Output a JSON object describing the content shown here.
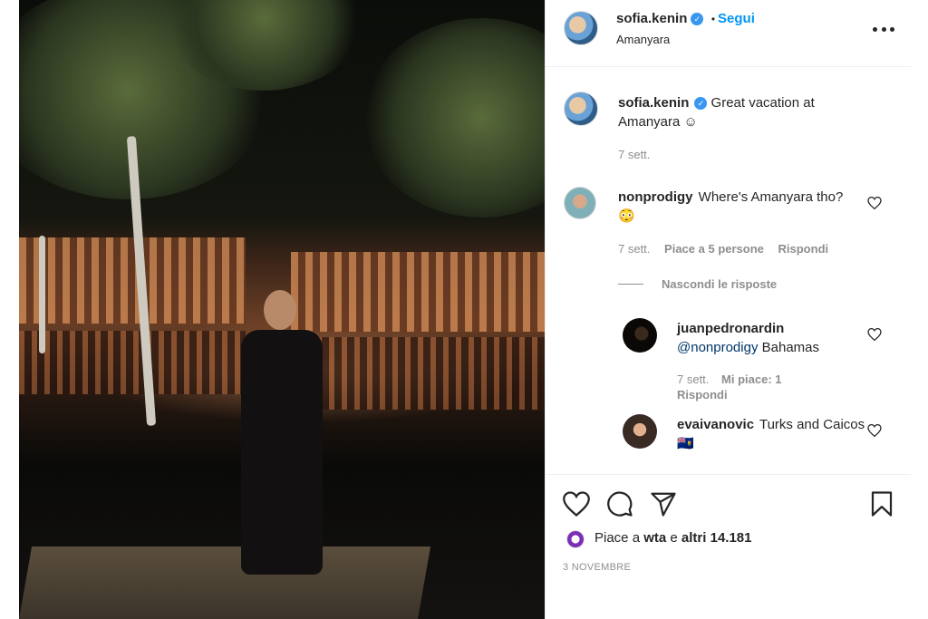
{
  "post": {
    "author": "sofia.kenin",
    "follow_label": "Segui",
    "separator": "•",
    "location": "Amanyara",
    "verified_glyph": "✓"
  },
  "caption": {
    "username": "sofia.kenin",
    "text": "Great vacation at Amanyara ☺",
    "time": "7 sett."
  },
  "comments": [
    {
      "username": "nonprodigy",
      "text": "Where's Amanyara tho? 😳",
      "time": "7 sett.",
      "likes": "Piace a 5 persone",
      "reply_label": "Rispondi"
    }
  ],
  "hide_replies_label": "Nascondi le risposte",
  "replies": [
    {
      "username": "juanpedronardin",
      "mention": "@nonprodigy",
      "text": "Bahamas",
      "time": "7 sett.",
      "likes": "Mi piace: 1",
      "reply_label": "Rispondi"
    },
    {
      "username": "evaivanovic",
      "text": "Turks and Caicos 🇹🇨"
    }
  ],
  "likes_line": {
    "prefix": "Piace a",
    "user": "wta",
    "middle": "e",
    "others": "altri 14.181"
  },
  "date": "3 NOVEMBRE",
  "icons": {
    "more": "more-options-icon",
    "like": "heart-icon",
    "comment": "comment-icon",
    "share": "share-icon",
    "save": "bookmark-icon"
  },
  "colors": {
    "accent": "#0095f6",
    "verified": "#3897f0",
    "text": "#262626",
    "muted": "#8e8e8e"
  }
}
